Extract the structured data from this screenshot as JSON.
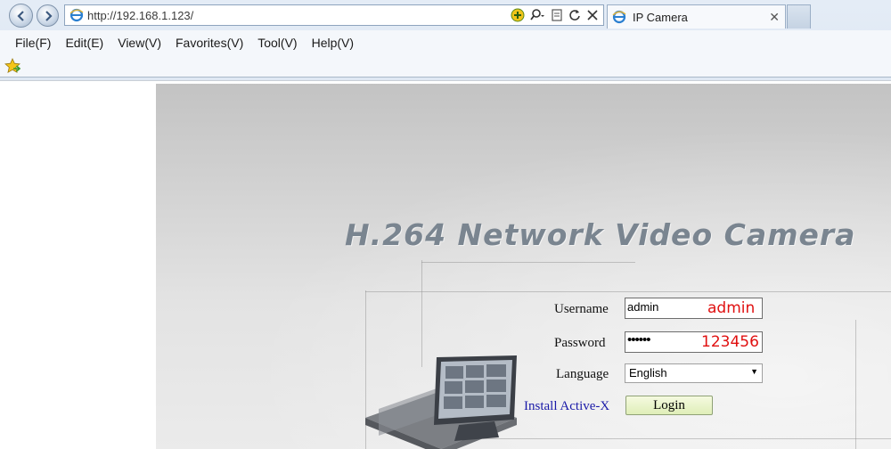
{
  "browser": {
    "address": "http://192.168.1.123/",
    "tab_title": "IP Camera",
    "tab_close": "✕",
    "menu": [
      "File(F)",
      "Edit(E)",
      "View(V)",
      "Favorites(V)",
      "Tool(V)",
      "Help(V)"
    ],
    "icons": {
      "back": "back-arrow-icon",
      "forward": "forward-arrow-icon",
      "page": "ie-icon",
      "compat": "compatibility-icon",
      "search": "search-icon",
      "refresh": "refresh-icon",
      "close": "close-icon",
      "favorites": "favorites-star-icon"
    }
  },
  "login": {
    "product_title": "H.264 Network Video Camera",
    "username_label": "Username",
    "username_value": "admin",
    "username_hint": "admin",
    "password_label": "Password",
    "password_value": "••••••",
    "password_hint": "123456",
    "language_label": "Language",
    "language_value": "English",
    "activex_link": "Install Active-X",
    "login_button": "Login"
  },
  "colors": {
    "hint": "#e01010",
    "link": "#1a1aa8",
    "title": "#7a8590"
  }
}
